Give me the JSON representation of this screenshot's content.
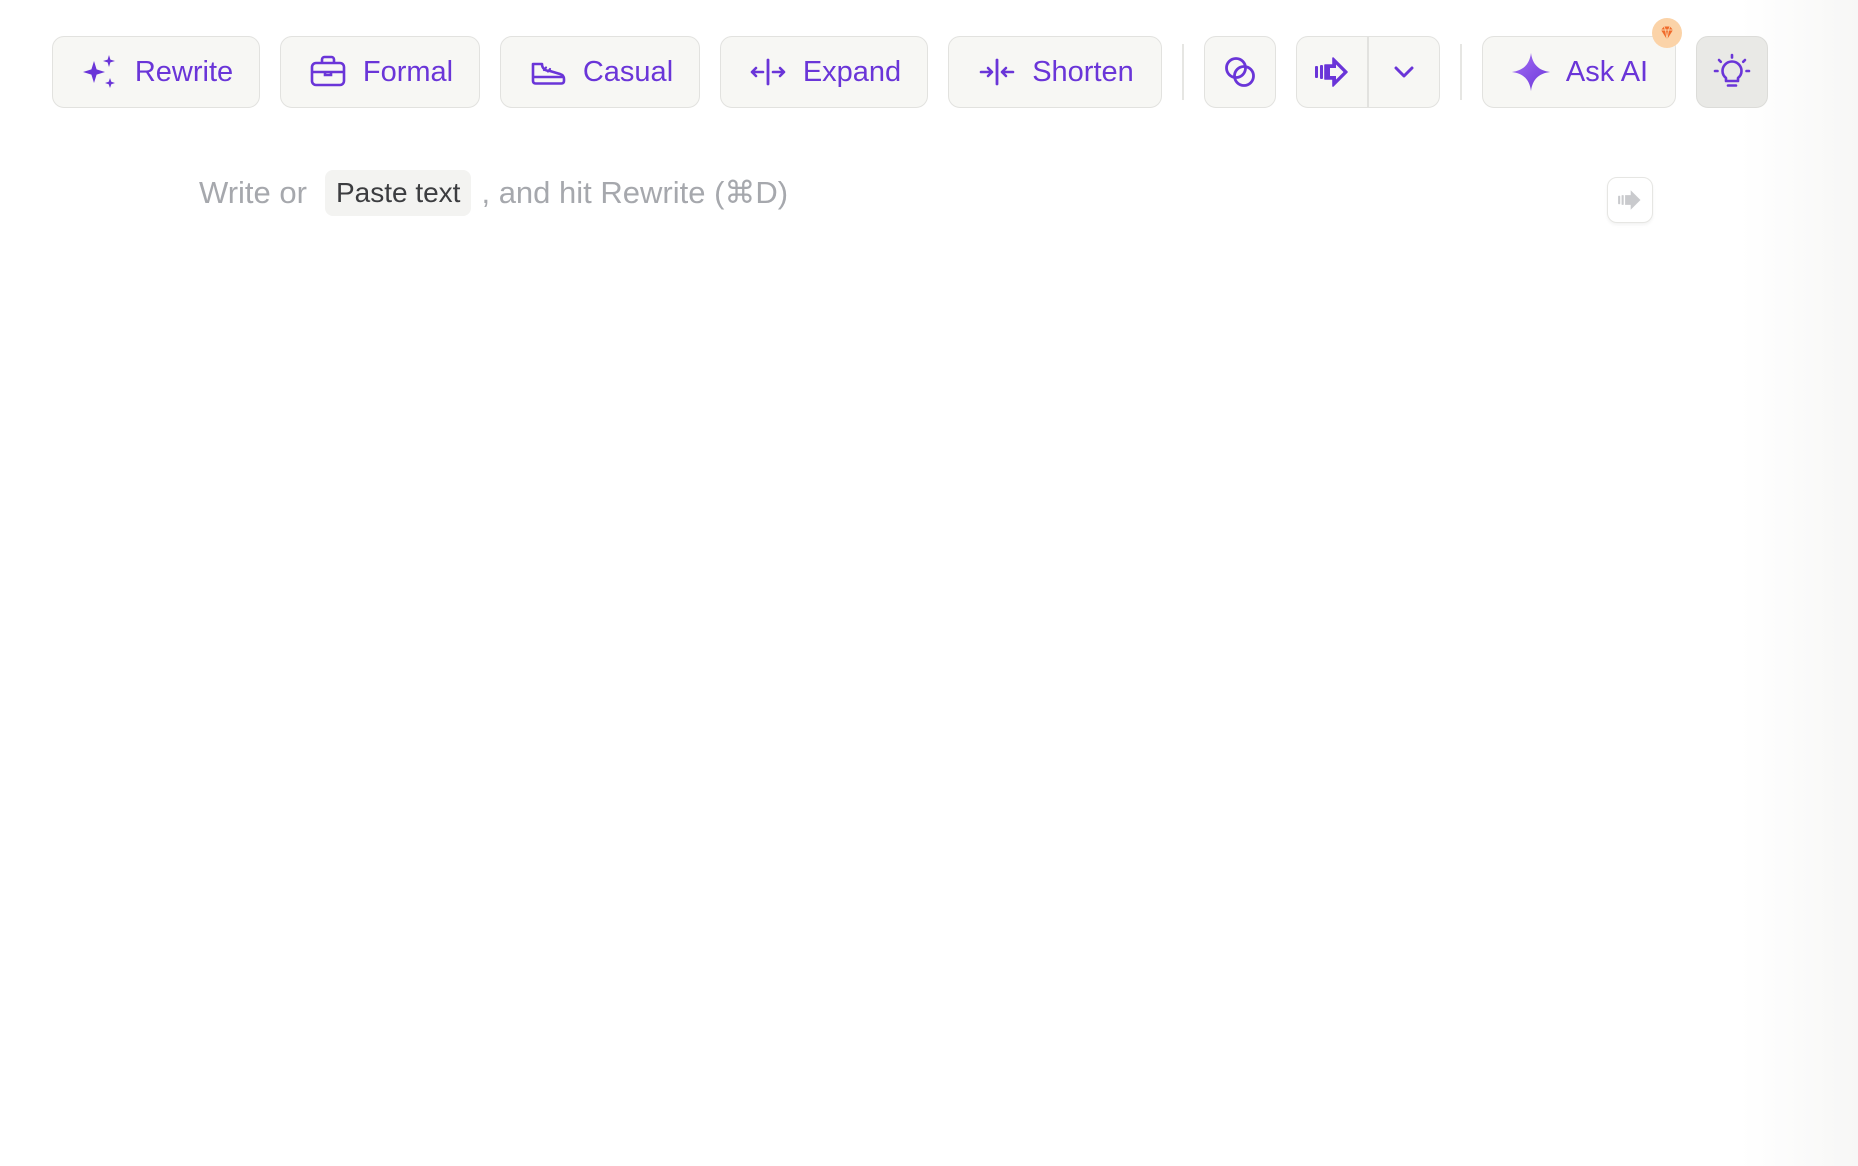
{
  "toolbar": {
    "buttons": [
      {
        "label": "Rewrite",
        "icon": "sparkles-icon"
      },
      {
        "label": "Formal",
        "icon": "briefcase-icon"
      },
      {
        "label": "Casual",
        "icon": "sneaker-icon"
      },
      {
        "label": "Expand",
        "icon": "expand-arrows-icon"
      },
      {
        "label": "Shorten",
        "icon": "shorten-arrows-icon"
      }
    ],
    "overlap_icon": "overlapping-circles-icon",
    "speak_icon": "speak-arrow-icon",
    "dropdown_icon": "chevron-down-icon",
    "ask_ai": {
      "label": "Ask AI",
      "icon": "ai-sparkle-icon",
      "badge_icon": "gem-icon"
    },
    "tips_icon": "lightbulb-icon"
  },
  "editor": {
    "hint_prefix": "Write or",
    "paste_label": "Paste text",
    "hint_suffix": ", and hit Rewrite (⌘D)",
    "side_icon": "speak-arrow-icon"
  },
  "colors": {
    "accent": "#6a35d8",
    "button_bg": "#f7f7f4",
    "button_border": "#e2e2df",
    "placeholder": "#a6a8ad",
    "badge": "#f06a2a",
    "badge_bg": "#fbd3a8"
  }
}
